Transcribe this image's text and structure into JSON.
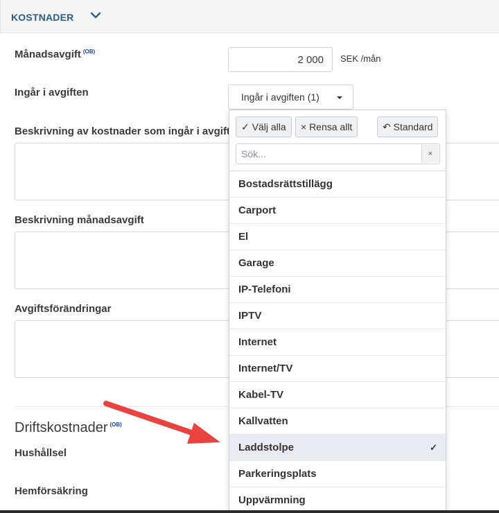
{
  "section": {
    "title": "KOSTNADER"
  },
  "fields": {
    "monthly_fee_label": "Månadsavgift",
    "ob_tag": "(OB)",
    "monthly_fee_value": "2 000",
    "monthly_fee_unit": "SEK /mån",
    "included_label": "Ingår i avgiften",
    "included_button": "Ingår i avgiften (1)",
    "desc_included_label": "Beskrivning av kostnader som ingår i avgifte",
    "desc_fee_label": "Beskrivning månadsavgift",
    "fee_changes_label": "Avgiftsförändringar"
  },
  "operating": {
    "title": "Driftskostnader",
    "ob_tag": "(OB)",
    "household_label": "Hushållsel",
    "home_insurance_label": "Hemförsäkring"
  },
  "dropdown": {
    "select_all": "✓ Välj alla",
    "clear_all": "× Rensa allt",
    "default": "↶ Standard",
    "search_placeholder": "Sök...",
    "clear_icon": "×",
    "check_mark": "✓",
    "items": [
      {
        "label": "Bostadsrättstillägg",
        "selected": false
      },
      {
        "label": "Carport",
        "selected": false
      },
      {
        "label": "El",
        "selected": false
      },
      {
        "label": "Garage",
        "selected": false
      },
      {
        "label": "IP-Telefoni",
        "selected": false
      },
      {
        "label": "IPTV",
        "selected": false
      },
      {
        "label": "Internet",
        "selected": false
      },
      {
        "label": "Internet/TV",
        "selected": false
      },
      {
        "label": "Kabel-TV",
        "selected": false
      },
      {
        "label": "Kallvatten",
        "selected": false
      },
      {
        "label": "Laddstolpe",
        "selected": true
      },
      {
        "label": "Parkeringsplats",
        "selected": false
      },
      {
        "label": "Uppvärmning",
        "selected": false
      }
    ]
  },
  "colors": {
    "section_title": "#2a5d8a",
    "ob_tag": "#1a3fd1",
    "arrow": "#e8433f",
    "selected_row": "#e8ecf2"
  }
}
